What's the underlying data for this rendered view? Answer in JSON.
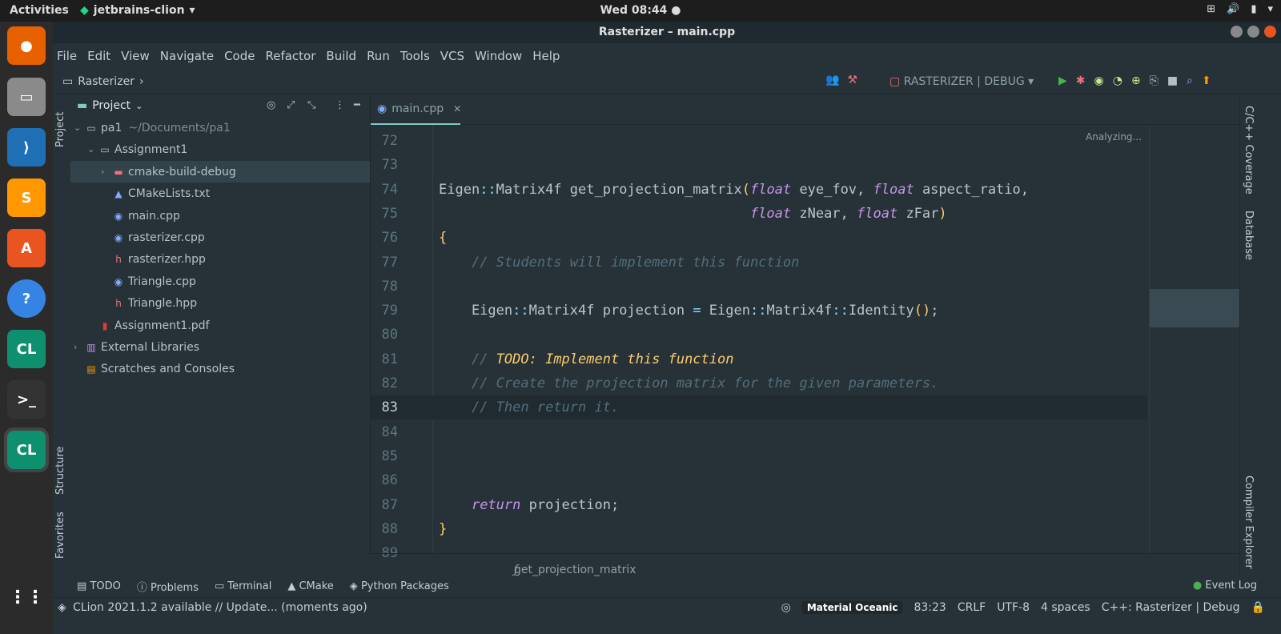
{
  "topbar": {
    "activities": "Activities",
    "app": "jetbrains-clion",
    "clock": "Wed 08:44 ●"
  },
  "window": {
    "title": "Rasterizer – main.cpp"
  },
  "menu": [
    "File",
    "Edit",
    "View",
    "Navigate",
    "Code",
    "Refactor",
    "Build",
    "Run",
    "Tools",
    "VCS",
    "Window",
    "Help"
  ],
  "nav": {
    "project": "Rasterizer",
    "config": "RASTERIZER | DEBUG"
  },
  "side": {
    "project_tab": "Project",
    "structure_tab": "Structure",
    "favorites_tab": "Favorites",
    "project_label": "Project"
  },
  "tree": [
    {
      "label": "pa1",
      "extra": "~/Documents/pa1",
      "icon": "folder-icon",
      "arrow": "⌄"
    },
    {
      "label": "Assignment1",
      "icon": "folder-icon",
      "arrow": "⌄"
    },
    {
      "label": "cmake-build-debug",
      "icon": "folder-red-icon",
      "arrow": "›"
    },
    {
      "label": "CMakeLists.txt",
      "icon": "cmake-icon"
    },
    {
      "label": "main.cpp",
      "icon": "cpp-icon"
    },
    {
      "label": "rasterizer.cpp",
      "icon": "cpp-icon"
    },
    {
      "label": "rasterizer.hpp",
      "icon": "hpp-icon"
    },
    {
      "label": "Triangle.cpp",
      "icon": "cpp-icon"
    },
    {
      "label": "Triangle.hpp",
      "icon": "hpp-icon"
    },
    {
      "label": "Assignment1.pdf",
      "icon": "pdf-icon"
    },
    {
      "label": "External Libraries",
      "icon": "library-icon",
      "arrow": "›"
    },
    {
      "label": "Scratches and Consoles",
      "icon": "scratch-icon"
    }
  ],
  "editor": {
    "tab": "main.cpp",
    "status": "Analyzing...",
    "lines": [
      {
        "n": "72",
        "c": ""
      },
      {
        "n": "73",
        "c": ""
      },
      {
        "n": "74",
        "c": "Eigen::Matrix4f get_projection_matrix(float eye_fov, float aspect_ratio,"
      },
      {
        "n": "75",
        "c": "                                      float zNear, float zFar)"
      },
      {
        "n": "76",
        "c": "{"
      },
      {
        "n": "77",
        "c": "    // Students will implement this function"
      },
      {
        "n": "78",
        "c": ""
      },
      {
        "n": "79",
        "c": "    Eigen::Matrix4f projection = Eigen::Matrix4f::Identity();"
      },
      {
        "n": "80",
        "c": ""
      },
      {
        "n": "81",
        "c": "    // TODO: Implement this function"
      },
      {
        "n": "82",
        "c": "    // Create the projection matrix for the given parameters."
      },
      {
        "n": "83",
        "c": "    // Then return it."
      },
      {
        "n": "84",
        "c": ""
      },
      {
        "n": "85",
        "c": ""
      },
      {
        "n": "86",
        "c": ""
      },
      {
        "n": "87",
        "c": "    return projection;"
      },
      {
        "n": "88",
        "c": "}"
      },
      {
        "n": "89",
        "c": ""
      }
    ],
    "current_line": "83",
    "breadcrumb": "get_projection_matrix"
  },
  "right_tabs": [
    "C/C++ Coverage",
    "Database",
    "Compiler Explorer"
  ],
  "bottom_tabs": [
    "TODO",
    "Problems",
    "Terminal",
    "CMake",
    "Python Packages"
  ],
  "event_log": "Event Log",
  "status": {
    "message": "CLion 2021.1.2 available // Update... (moments ago)",
    "theme": "Material Oceanic",
    "position": "83:23",
    "eol": "CRLF",
    "encoding": "UTF-8",
    "indent": "4 spaces",
    "context": "C++: Rasterizer | Debug"
  }
}
